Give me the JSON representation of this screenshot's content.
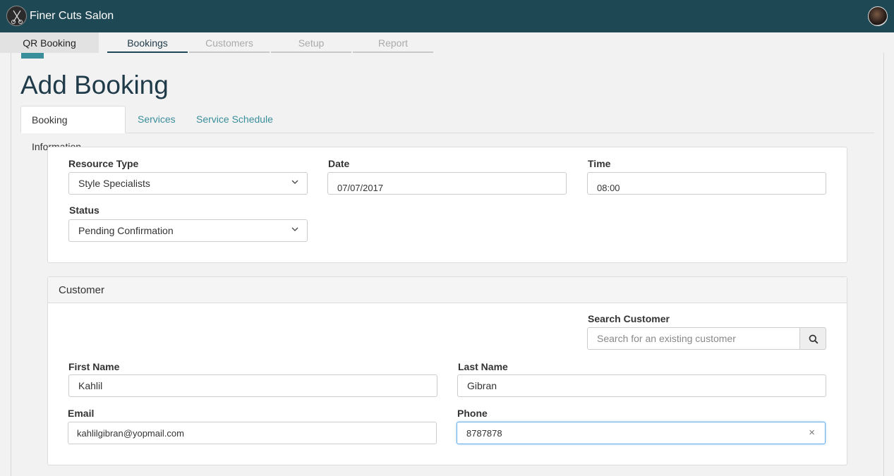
{
  "app": {
    "title": "Finer Cuts Salon",
    "header_color": "#1f4855",
    "logo_icon": "scissors-logo-icon",
    "avatar_icon": "user-avatar"
  },
  "nav": {
    "items": [
      {
        "label": "QR Booking",
        "state": "highlight"
      },
      {
        "label": "Bookings",
        "state": "active"
      },
      {
        "label": "Customers",
        "state": "disabled"
      },
      {
        "label": "Setup",
        "state": "disabled"
      },
      {
        "label": "Report",
        "state": "disabled"
      }
    ]
  },
  "page": {
    "title": "Add Booking"
  },
  "tabs": [
    {
      "label": "Booking Information",
      "active": true
    },
    {
      "label": "Services",
      "active": false
    },
    {
      "label": "Service Schedule",
      "active": false
    }
  ],
  "booking": {
    "resource_type": {
      "label": "Resource Type",
      "value": "Style Specialists"
    },
    "date": {
      "label": "Date",
      "value": "07/07/2017"
    },
    "time": {
      "label": "Time",
      "value": "08:00"
    },
    "status": {
      "label": "Status",
      "value": "Pending Confirmation"
    }
  },
  "customer": {
    "heading": "Customer",
    "search": {
      "label": "Search Customer",
      "placeholder": "Search for an existing customer",
      "icon": "search-icon"
    },
    "first_name": {
      "label": "First Name",
      "value": "Kahlil"
    },
    "last_name": {
      "label": "Last Name",
      "value": "Gibran"
    },
    "email": {
      "label": "Email",
      "value": "kahlilgibran@yopmail.com"
    },
    "phone": {
      "label": "Phone",
      "value": "8787878",
      "clear_label": "×"
    }
  },
  "colors": {
    "accent": "#3a8e9a",
    "title": "#1f3a48"
  }
}
